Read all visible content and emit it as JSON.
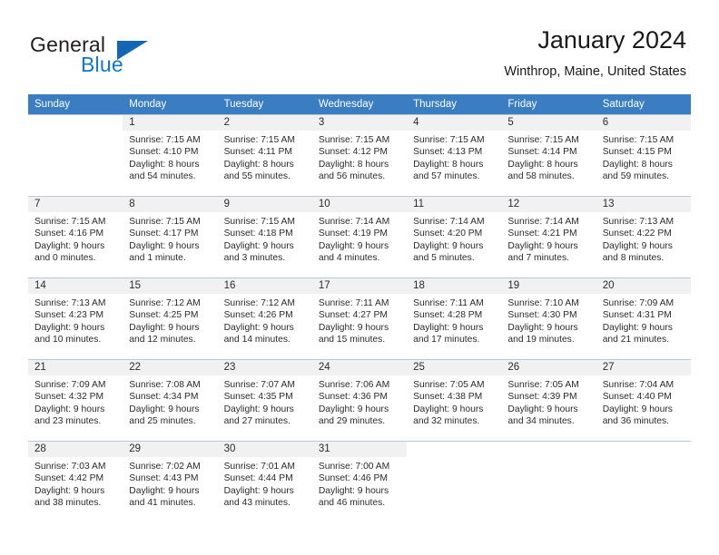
{
  "brand": {
    "name_top": "General",
    "name_bottom": "Blue",
    "triangle_icon": "triangle-icon",
    "accent_color": "#1277c6"
  },
  "header": {
    "month_title": "January 2024",
    "location": "Winthrop, Maine, United States",
    "header_bg_color": "#3a7dc0"
  },
  "weekday_headers": [
    "Sunday",
    "Monday",
    "Tuesday",
    "Wednesday",
    "Thursday",
    "Friday",
    "Saturday"
  ],
  "labels": {
    "sunrise_prefix": "Sunrise: ",
    "sunset_prefix": "Sunset: ",
    "daylight_prefix": "Daylight: "
  },
  "weeks": [
    [
      {
        "blank": true
      },
      {
        "day": "1",
        "sunrise": "Sunrise: 7:15 AM",
        "sunset": "Sunset: 4:10 PM",
        "daylight1": "Daylight: 8 hours",
        "daylight2": "and 54 minutes."
      },
      {
        "day": "2",
        "sunrise": "Sunrise: 7:15 AM",
        "sunset": "Sunset: 4:11 PM",
        "daylight1": "Daylight: 8 hours",
        "daylight2": "and 55 minutes."
      },
      {
        "day": "3",
        "sunrise": "Sunrise: 7:15 AM",
        "sunset": "Sunset: 4:12 PM",
        "daylight1": "Daylight: 8 hours",
        "daylight2": "and 56 minutes."
      },
      {
        "day": "4",
        "sunrise": "Sunrise: 7:15 AM",
        "sunset": "Sunset: 4:13 PM",
        "daylight1": "Daylight: 8 hours",
        "daylight2": "and 57 minutes."
      },
      {
        "day": "5",
        "sunrise": "Sunrise: 7:15 AM",
        "sunset": "Sunset: 4:14 PM",
        "daylight1": "Daylight: 8 hours",
        "daylight2": "and 58 minutes."
      },
      {
        "day": "6",
        "sunrise": "Sunrise: 7:15 AM",
        "sunset": "Sunset: 4:15 PM",
        "daylight1": "Daylight: 8 hours",
        "daylight2": "and 59 minutes."
      }
    ],
    [
      {
        "day": "7",
        "sunrise": "Sunrise: 7:15 AM",
        "sunset": "Sunset: 4:16 PM",
        "daylight1": "Daylight: 9 hours",
        "daylight2": "and 0 minutes."
      },
      {
        "day": "8",
        "sunrise": "Sunrise: 7:15 AM",
        "sunset": "Sunset: 4:17 PM",
        "daylight1": "Daylight: 9 hours",
        "daylight2": "and 1 minute."
      },
      {
        "day": "9",
        "sunrise": "Sunrise: 7:15 AM",
        "sunset": "Sunset: 4:18 PM",
        "daylight1": "Daylight: 9 hours",
        "daylight2": "and 3 minutes."
      },
      {
        "day": "10",
        "sunrise": "Sunrise: 7:14 AM",
        "sunset": "Sunset: 4:19 PM",
        "daylight1": "Daylight: 9 hours",
        "daylight2": "and 4 minutes."
      },
      {
        "day": "11",
        "sunrise": "Sunrise: 7:14 AM",
        "sunset": "Sunset: 4:20 PM",
        "daylight1": "Daylight: 9 hours",
        "daylight2": "and 5 minutes."
      },
      {
        "day": "12",
        "sunrise": "Sunrise: 7:14 AM",
        "sunset": "Sunset: 4:21 PM",
        "daylight1": "Daylight: 9 hours",
        "daylight2": "and 7 minutes."
      },
      {
        "day": "13",
        "sunrise": "Sunrise: 7:13 AM",
        "sunset": "Sunset: 4:22 PM",
        "daylight1": "Daylight: 9 hours",
        "daylight2": "and 8 minutes."
      }
    ],
    [
      {
        "day": "14",
        "sunrise": "Sunrise: 7:13 AM",
        "sunset": "Sunset: 4:23 PM",
        "daylight1": "Daylight: 9 hours",
        "daylight2": "and 10 minutes."
      },
      {
        "day": "15",
        "sunrise": "Sunrise: 7:12 AM",
        "sunset": "Sunset: 4:25 PM",
        "daylight1": "Daylight: 9 hours",
        "daylight2": "and 12 minutes."
      },
      {
        "day": "16",
        "sunrise": "Sunrise: 7:12 AM",
        "sunset": "Sunset: 4:26 PM",
        "daylight1": "Daylight: 9 hours",
        "daylight2": "and 14 minutes."
      },
      {
        "day": "17",
        "sunrise": "Sunrise: 7:11 AM",
        "sunset": "Sunset: 4:27 PM",
        "daylight1": "Daylight: 9 hours",
        "daylight2": "and 15 minutes."
      },
      {
        "day": "18",
        "sunrise": "Sunrise: 7:11 AM",
        "sunset": "Sunset: 4:28 PM",
        "daylight1": "Daylight: 9 hours",
        "daylight2": "and 17 minutes."
      },
      {
        "day": "19",
        "sunrise": "Sunrise: 7:10 AM",
        "sunset": "Sunset: 4:30 PM",
        "daylight1": "Daylight: 9 hours",
        "daylight2": "and 19 minutes."
      },
      {
        "day": "20",
        "sunrise": "Sunrise: 7:09 AM",
        "sunset": "Sunset: 4:31 PM",
        "daylight1": "Daylight: 9 hours",
        "daylight2": "and 21 minutes."
      }
    ],
    [
      {
        "day": "21",
        "sunrise": "Sunrise: 7:09 AM",
        "sunset": "Sunset: 4:32 PM",
        "daylight1": "Daylight: 9 hours",
        "daylight2": "and 23 minutes."
      },
      {
        "day": "22",
        "sunrise": "Sunrise: 7:08 AM",
        "sunset": "Sunset: 4:34 PM",
        "daylight1": "Daylight: 9 hours",
        "daylight2": "and 25 minutes."
      },
      {
        "day": "23",
        "sunrise": "Sunrise: 7:07 AM",
        "sunset": "Sunset: 4:35 PM",
        "daylight1": "Daylight: 9 hours",
        "daylight2": "and 27 minutes."
      },
      {
        "day": "24",
        "sunrise": "Sunrise: 7:06 AM",
        "sunset": "Sunset: 4:36 PM",
        "daylight1": "Daylight: 9 hours",
        "daylight2": "and 29 minutes."
      },
      {
        "day": "25",
        "sunrise": "Sunrise: 7:05 AM",
        "sunset": "Sunset: 4:38 PM",
        "daylight1": "Daylight: 9 hours",
        "daylight2": "and 32 minutes."
      },
      {
        "day": "26",
        "sunrise": "Sunrise: 7:05 AM",
        "sunset": "Sunset: 4:39 PM",
        "daylight1": "Daylight: 9 hours",
        "daylight2": "and 34 minutes."
      },
      {
        "day": "27",
        "sunrise": "Sunrise: 7:04 AM",
        "sunset": "Sunset: 4:40 PM",
        "daylight1": "Daylight: 9 hours",
        "daylight2": "and 36 minutes."
      }
    ],
    [
      {
        "day": "28",
        "sunrise": "Sunrise: 7:03 AM",
        "sunset": "Sunset: 4:42 PM",
        "daylight1": "Daylight: 9 hours",
        "daylight2": "and 38 minutes."
      },
      {
        "day": "29",
        "sunrise": "Sunrise: 7:02 AM",
        "sunset": "Sunset: 4:43 PM",
        "daylight1": "Daylight: 9 hours",
        "daylight2": "and 41 minutes."
      },
      {
        "day": "30",
        "sunrise": "Sunrise: 7:01 AM",
        "sunset": "Sunset: 4:44 PM",
        "daylight1": "Daylight: 9 hours",
        "daylight2": "and 43 minutes."
      },
      {
        "day": "31",
        "sunrise": "Sunrise: 7:00 AM",
        "sunset": "Sunset: 4:46 PM",
        "daylight1": "Daylight: 9 hours",
        "daylight2": "and 46 minutes."
      },
      {
        "blank": true
      },
      {
        "blank": true
      },
      {
        "blank": true
      }
    ]
  ]
}
